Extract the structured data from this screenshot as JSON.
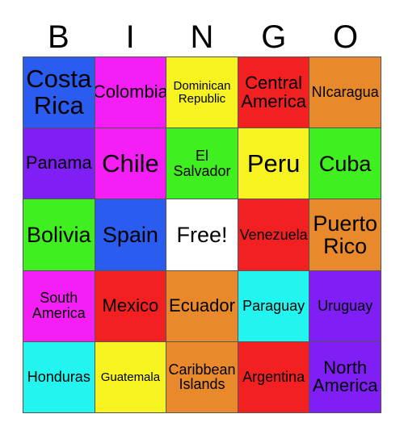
{
  "card": {
    "title_letters": [
      "B",
      "I",
      "N",
      "G",
      "O"
    ],
    "colors": {
      "blue": "#2B5CF0",
      "magenta": "#F51FF5",
      "yellow": "#F7F321",
      "red": "#F22020",
      "orange": "#E8892B",
      "purple": "#7F1FF5",
      "green": "#3FEF1F",
      "cyan": "#22F5EF",
      "white": "#FFFFFF",
      "text": "#000000",
      "border": "#555555",
      "background": "#FFFFFF"
    },
    "rows": [
      [
        {
          "label": "Costa\nRica",
          "color": "#2B5CF0",
          "size": "fs-xl"
        },
        {
          "label": "Colombia",
          "color": "#F51FF5",
          "size": "fs-md"
        },
        {
          "label": "Dominican\nRepublic",
          "color": "#F7F321",
          "size": "fs-xs"
        },
        {
          "label": "Central\nAmerica",
          "color": "#F22020",
          "size": "fs-md"
        },
        {
          "label": "NIcaragua",
          "color": "#E8892B",
          "size": "fs-sm"
        }
      ],
      [
        {
          "label": "Panama",
          "color": "#7F1FF5",
          "size": "fs-md"
        },
        {
          "label": "Chile",
          "color": "#F51FF5",
          "size": "fs-xl"
        },
        {
          "label": "El\nSalvador",
          "color": "#3FEF1F",
          "size": "fs-sm"
        },
        {
          "label": "Peru",
          "color": "#F7F321",
          "size": "fs-xl"
        },
        {
          "label": "Cuba",
          "color": "#3FEF1F",
          "size": "fs-lg"
        }
      ],
      [
        {
          "label": "Bolivia",
          "color": "#3FEF1F",
          "size": "fs-lg"
        },
        {
          "label": "Spain",
          "color": "#2B5CF0",
          "size": "fs-lg"
        },
        {
          "label": "Free!",
          "color": "#FFFFFF",
          "size": "fs-lg"
        },
        {
          "label": "Venezuela",
          "color": "#F22020",
          "size": "fs-sm"
        },
        {
          "label": "Puerto\nRico",
          "color": "#E8892B",
          "size": "fs-lg"
        }
      ],
      [
        {
          "label": "South\nAmerica",
          "color": "#F51FF5",
          "size": "fs-sm"
        },
        {
          "label": "Mexico",
          "color": "#F22020",
          "size": "fs-md"
        },
        {
          "label": "Ecuador",
          "color": "#E8892B",
          "size": "fs-md"
        },
        {
          "label": "Paraguay",
          "color": "#22F5EF",
          "size": "fs-sm"
        },
        {
          "label": "Uruguay",
          "color": "#7F1FF5",
          "size": "fs-sm"
        }
      ],
      [
        {
          "label": "Honduras",
          "color": "#22F5EF",
          "size": "fs-sm"
        },
        {
          "label": "Guatemala",
          "color": "#F7F321",
          "size": "fs-xs"
        },
        {
          "label": "Caribbean\nIslands",
          "color": "#E8892B",
          "size": "fs-sm"
        },
        {
          "label": "Argentina",
          "color": "#F22020",
          "size": "fs-sm"
        },
        {
          "label": "North\nAmerica",
          "color": "#7F1FF5",
          "size": "fs-md"
        }
      ]
    ]
  }
}
